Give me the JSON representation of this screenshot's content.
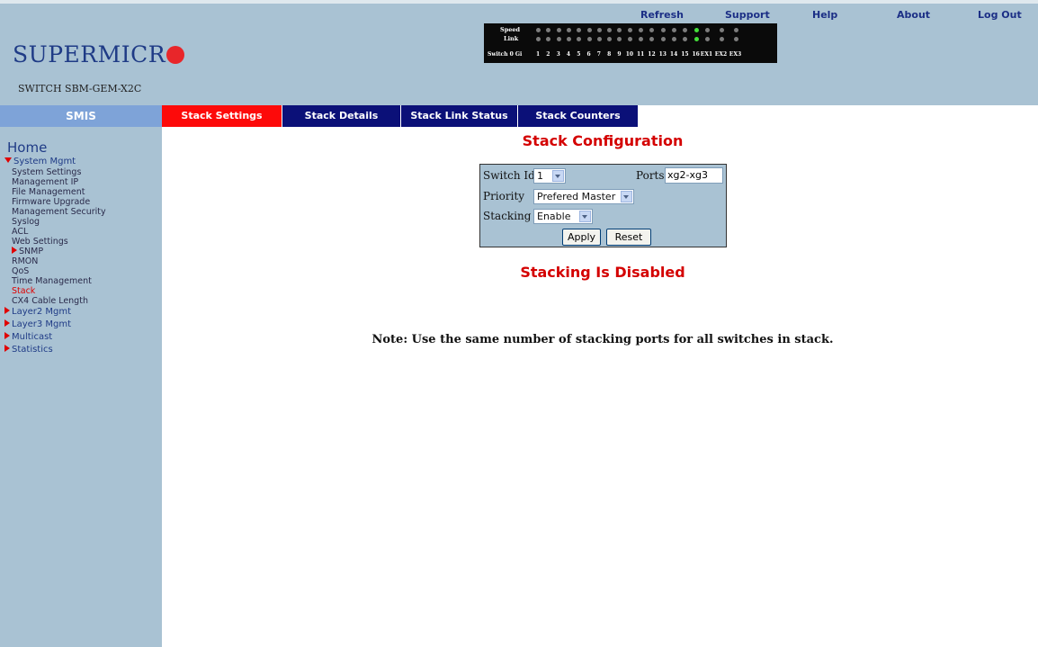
{
  "header": {
    "links": [
      "Refresh",
      "Support",
      "Help",
      "About",
      "Log Out"
    ],
    "logo_text": "SUPERMICR",
    "model": "SWITCH SBM-GEM-X2C",
    "port_panel": {
      "speed_label": "Speed",
      "link_label": "Link",
      "switch_label": "Switch 0 Gi",
      "port_numbers": [
        "1",
        "2",
        "3",
        "4",
        "5",
        "6",
        "7",
        "8",
        "9",
        "10",
        "11",
        "12",
        "13",
        "14",
        "15",
        "16",
        "EX1",
        "EX2",
        "EX3"
      ],
      "speed_on": [
        16
      ],
      "link_on": [
        16
      ]
    }
  },
  "nav": {
    "smis": "SMIS",
    "tabs": [
      "Stack Settings",
      "Stack Details",
      "Stack Link Status",
      "Stack Counters"
    ],
    "active_tab": 0
  },
  "sidebar": {
    "home": "Home",
    "system_mgmt": "System Mgmt",
    "items": [
      "System Settings",
      "Management IP",
      "File Management",
      "Firmware Upgrade",
      "Management Security",
      "Syslog",
      "ACL",
      "Web Settings",
      "SNMP",
      "RMON",
      "QoS",
      "Time Management",
      "Stack",
      "CX4 Cable Length"
    ],
    "sections": [
      "Layer2 Mgmt",
      "Layer3 Mgmt",
      "Multicast",
      "Statistics"
    ]
  },
  "main": {
    "title": "Stack Configuration",
    "form": {
      "switch_id_label": "Switch Id",
      "switch_id_value": "1",
      "ports_label": "Ports",
      "ports_value": "xg2-xg3",
      "priority_label": "Priority",
      "priority_value": "Prefered Master",
      "stacking_label": "Stacking",
      "stacking_value": "Enable",
      "apply": "Apply",
      "reset": "Reset"
    },
    "status": "Stacking Is Disabled",
    "note": "Note: Use the same number of stacking ports for all switches in stack."
  },
  "colors": {
    "header_bg": "#a9c2d3",
    "tab_active": "#fd0a0a",
    "tab_normal": "#0b1078",
    "title_red": "#d40000",
    "link_blue": "#1c2f86"
  }
}
